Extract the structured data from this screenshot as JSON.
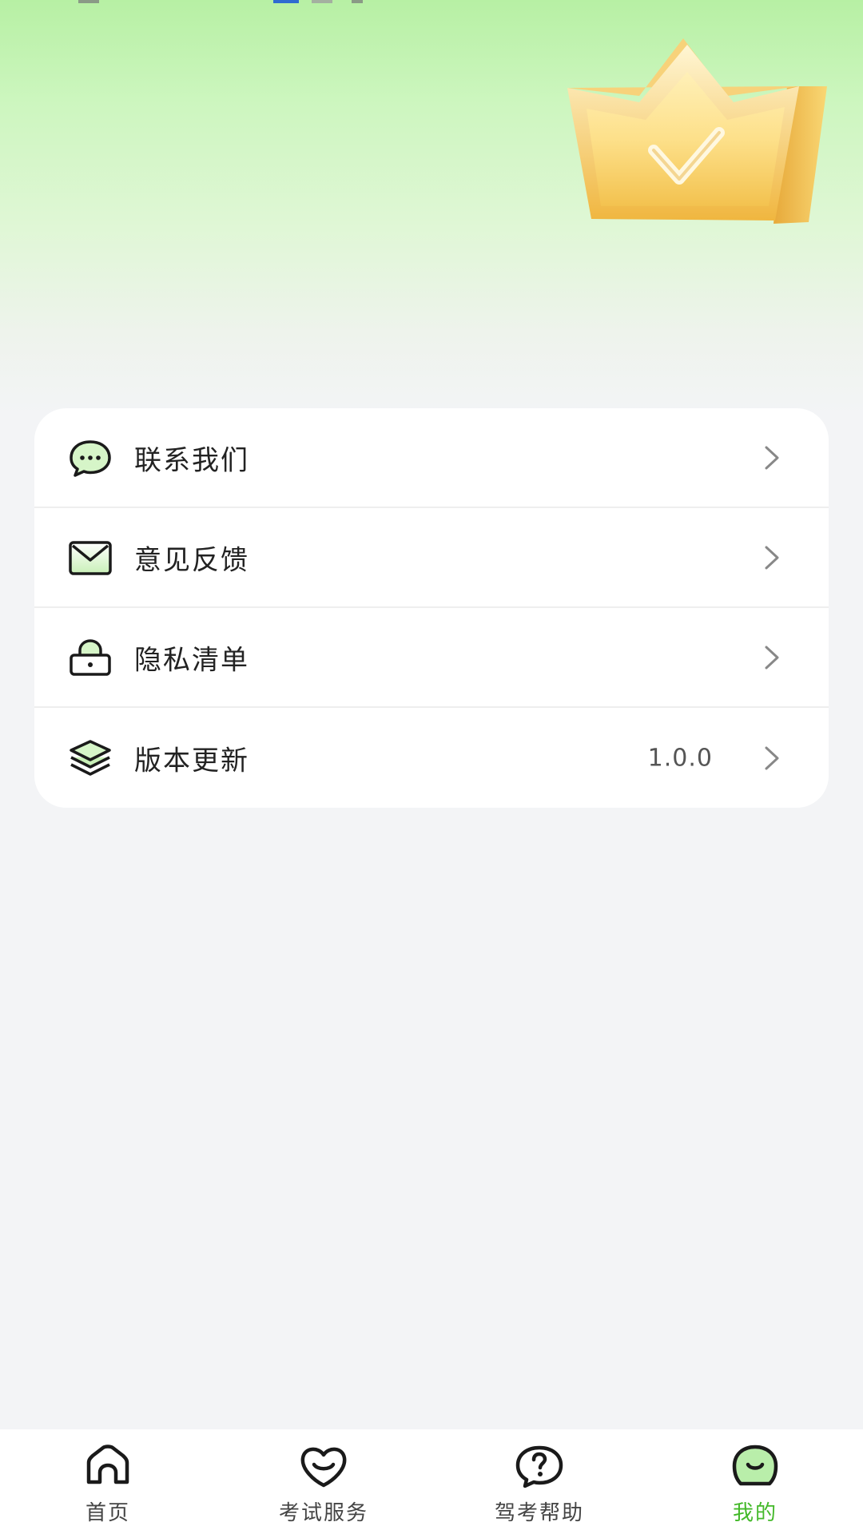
{
  "colors": {
    "accent": "#43b929",
    "header_top": "#b7f0a4",
    "background": "#f3f4f6",
    "icon_fill": "#d6f5c8"
  },
  "hero": {
    "crown_icon": "crown-check-icon"
  },
  "menu": {
    "items": [
      {
        "icon": "chat-bubble-icon",
        "label": "联系我们",
        "value": ""
      },
      {
        "icon": "mail-icon",
        "label": "意见反馈",
        "value": ""
      },
      {
        "icon": "lock-icon",
        "label": "隐私清单",
        "value": ""
      },
      {
        "icon": "layers-icon",
        "label": "版本更新",
        "value": "1.0.0"
      }
    ]
  },
  "tabbar": {
    "tabs": [
      {
        "icon": "home-icon",
        "label": "首页",
        "active": false
      },
      {
        "icon": "heart-smile-icon",
        "label": "考试服务",
        "active": false
      },
      {
        "icon": "help-bubble-icon",
        "label": "驾考帮助",
        "active": false
      },
      {
        "icon": "profile-icon",
        "label": "我的",
        "active": true
      }
    ]
  }
}
